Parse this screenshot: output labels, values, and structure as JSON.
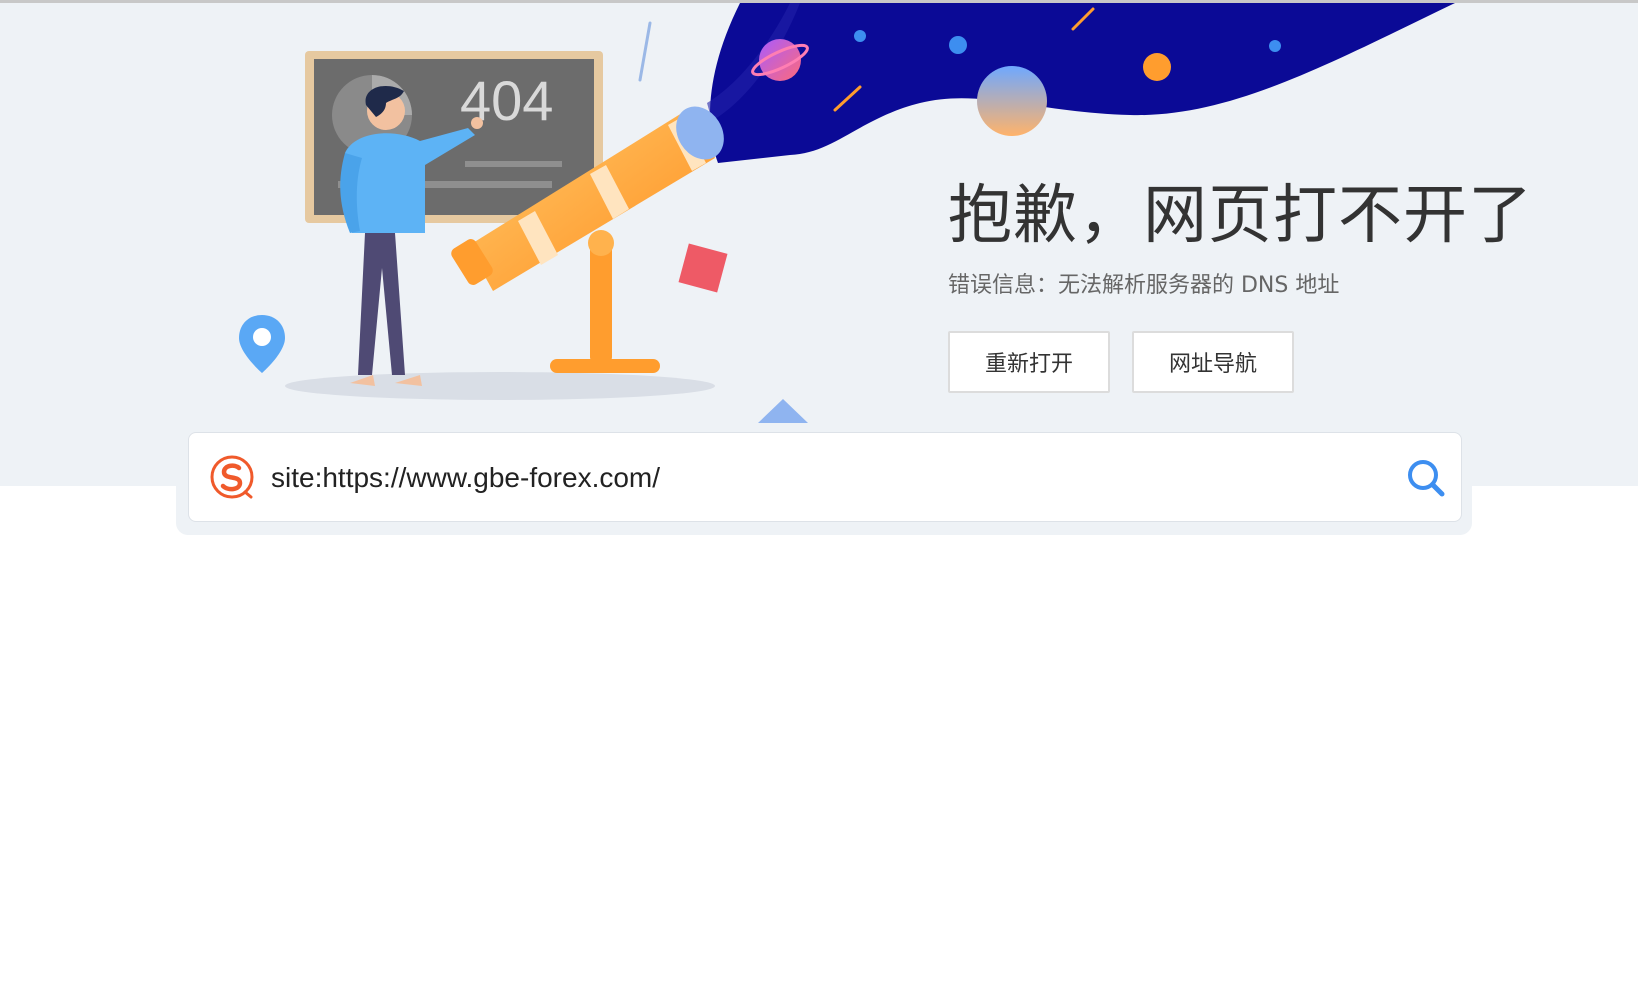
{
  "error_page": {
    "headline": "抱歉，网页打不开了",
    "error_message": "错误信息：无法解析服务器的 DNS 地址",
    "illustration_board_text": "404",
    "buttons": {
      "reopen_label": "重新打开",
      "url_nav_label": "网址导航"
    }
  },
  "search": {
    "query": "site:https://www.gbe-forex.com/",
    "logo_icon": "sogou-logo-icon",
    "submit_icon": "search-icon"
  },
  "colors": {
    "hero_background": "#eef2f6",
    "space_blue": "#0b0a96",
    "telescope_orange": "#ff9d2e",
    "logo_orange": "#f05a2b",
    "search_icon_blue": "#3d8ef0"
  }
}
